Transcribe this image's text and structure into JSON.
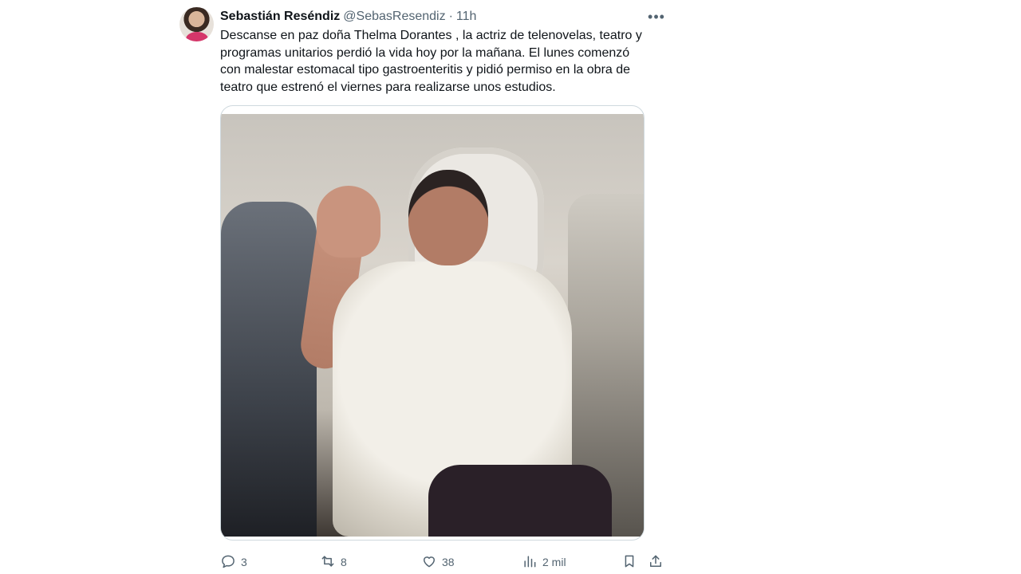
{
  "tweet": {
    "author": {
      "display_name": "Sebastián Reséndiz",
      "handle": "@SebasResendiz",
      "separator": "·",
      "time": "11h"
    },
    "more_icon": "more-horizontal-icon",
    "text": "Descanse en paz doña Thelma Dorantes , la actriz de telenovelas, teatro y\nprogramas unitarios perdió la vida hoy por la mañana. El lunes comenzó\ncon malestar estomacal tipo gastroenteritis y pidió permiso en la obra de\nteatro que estrenó el viernes para realizarse unos estudios.",
    "actions": {
      "reply": {
        "icon": "reply-icon",
        "count": "3"
      },
      "retweet": {
        "icon": "retweet-icon",
        "count": "8"
      },
      "like": {
        "icon": "heart-icon",
        "count": "38"
      },
      "views": {
        "icon": "analytics-icon",
        "count": "2 mil"
      },
      "bookmark": {
        "icon": "bookmark-icon"
      },
      "share": {
        "icon": "share-icon"
      }
    }
  }
}
